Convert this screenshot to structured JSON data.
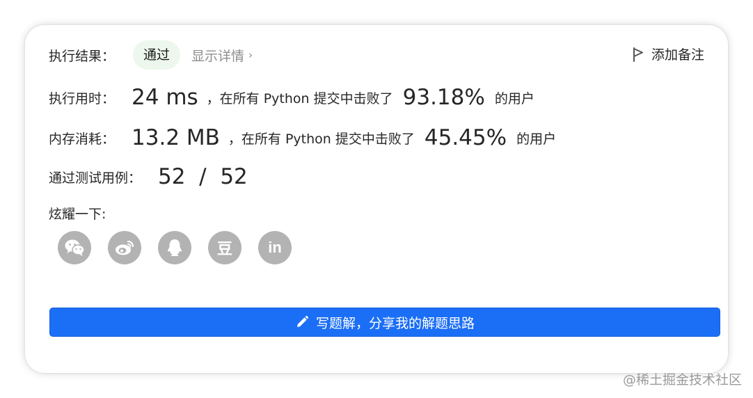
{
  "header": {
    "result_label": "执行结果：",
    "result_badge": "通过",
    "detail_link": "显示详情",
    "add_note": "添加备注"
  },
  "runtime": {
    "label": "执行用时：",
    "value": "24 ms",
    "text_before": "，在所有 Python 提交中击败了",
    "percent": "93.18%",
    "text_after": "的用户"
  },
  "memory": {
    "label": "内存消耗：",
    "value": "13.2 MB",
    "text_before": "，在所有 Python 提交中击败了",
    "percent": "45.45%",
    "text_after": "的用户"
  },
  "tests": {
    "label": "通过测试用例：",
    "value": "52  /  52"
  },
  "share": {
    "label": "炫耀一下:",
    "icons": [
      {
        "name": "wechat-icon"
      },
      {
        "name": "weibo-icon"
      },
      {
        "name": "qq-icon"
      },
      {
        "name": "douban-icon",
        "text": "豆"
      },
      {
        "name": "linkedin-icon",
        "text": "in"
      }
    ]
  },
  "write_solution_label": "写题解，分享我的解题思路",
  "watermark": "@稀土掘金技术社区",
  "colors": {
    "badge_bg": "#edf7ed",
    "primary_button": "#1b6ef6",
    "share_icon_bg": "#b3b3b3"
  }
}
